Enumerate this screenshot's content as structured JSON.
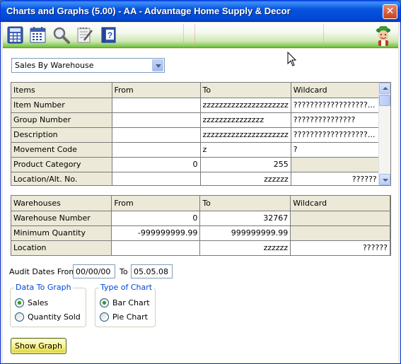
{
  "window": {
    "title": "Charts and Graphs (5.00) - AA - Advantage Home Supply & Decor",
    "close_glyph": "✕"
  },
  "toolbar": {
    "icons": [
      "calculator-icon",
      "calendar-icon",
      "magnifier-icon",
      "notepad-icon",
      "help-book-icon",
      "mascot-icon"
    ]
  },
  "report_select": {
    "value": "Sales By Warehouse"
  },
  "items_grid": {
    "headers": [
      "Items",
      "From",
      "To",
      "Wildcard"
    ],
    "rows": [
      {
        "label": "Item Number",
        "from": "",
        "to": "zzzzzzzzzzzzzzzzzzzzz",
        "wildcard": "??????????????????..."
      },
      {
        "label": "Group Number",
        "from": "",
        "to": "zzzzzzzzzzzzzzz",
        "wildcard": "???????????????"
      },
      {
        "label": "Description",
        "from": "",
        "to": "zzzzzzzzzzzzzzzzzzzzz",
        "wildcard": "??????????????????..."
      },
      {
        "label": "Movement Code",
        "from": "",
        "to": "z",
        "wildcard": "?"
      },
      {
        "label": "Product Category",
        "from": "0",
        "to": "255",
        "wildcard": ""
      },
      {
        "label": "Location/Alt. No.",
        "from": "",
        "to": "zzzzzz",
        "wildcard": "??????"
      }
    ]
  },
  "warehouse_grid": {
    "headers": [
      "Warehouses",
      "From",
      "To",
      "Wildcard"
    ],
    "rows": [
      {
        "label": "Warehouse Number",
        "from": "0",
        "to": "32767",
        "wildcard": ""
      },
      {
        "label": "Minimum Quantity",
        "from": "-999999999.99",
        "to": "999999999.99",
        "wildcard": ""
      },
      {
        "label": "Location",
        "from": "",
        "to": "zzzzzz",
        "wildcard": "??????"
      }
    ]
  },
  "audit_dates": {
    "label": "Audit Dates From",
    "from_value": "00/00/00",
    "to_label": "To",
    "to_value": "05.05.08"
  },
  "data_to_graph": {
    "title": "Data To Graph",
    "options": [
      {
        "label": "Sales",
        "checked": true
      },
      {
        "label": "Quantity Sold",
        "checked": false
      }
    ]
  },
  "type_of_chart": {
    "title": "Type of Chart",
    "options": [
      {
        "label": "Bar Chart",
        "checked": true
      },
      {
        "label": "Pie Chart",
        "checked": false
      }
    ]
  },
  "show_graph_button": {
    "label": "Show Graph"
  },
  "colors": {
    "title_bar": "#0753de",
    "toolbar_green": "#6fbf3c",
    "group_title": "#0046d5",
    "button_yellow": "#f7f28a"
  }
}
